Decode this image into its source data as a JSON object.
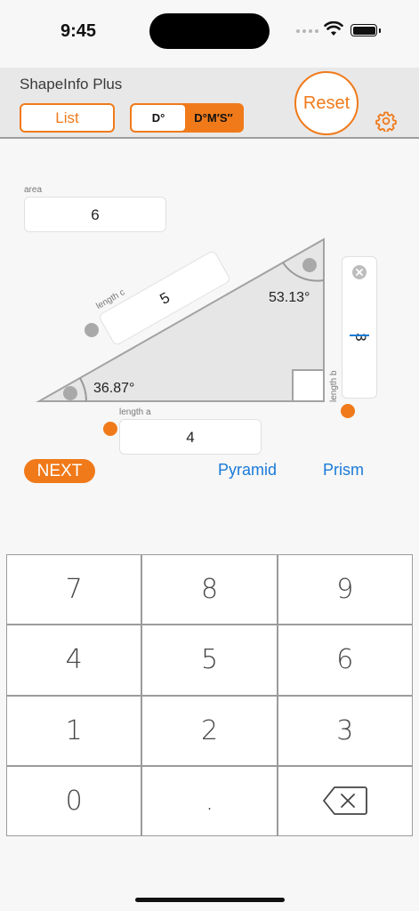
{
  "status": {
    "time": "9:45"
  },
  "header": {
    "title": "ShapeInfo Plus",
    "list_label": "List",
    "degrees_label": "D°",
    "dms_label": "D°M′S″",
    "reset_label": "Reset"
  },
  "fields": {
    "area": {
      "label": "area",
      "value": "6"
    },
    "length_a": {
      "label": "length a",
      "value": "4"
    },
    "length_b": {
      "label": "length b",
      "value": "3"
    },
    "length_c": {
      "label": "length c",
      "value": "5"
    }
  },
  "angles": {
    "top": "53.13°",
    "left": "36.87°"
  },
  "actions": {
    "next_label": "NEXT",
    "pyramid_label": "Pyramid",
    "prism_label": "Prism"
  },
  "keypad": {
    "keys": [
      "7",
      "8",
      "9",
      "4",
      "5",
      "6",
      "1",
      "2",
      "3",
      "0",
      "."
    ]
  },
  "colors": {
    "accent": "#f07a1a",
    "link": "#1a7ad8",
    "triangle_fill": "#e6e6e6"
  },
  "icons": [
    "wifi-icon",
    "battery-icon",
    "gear-icon",
    "clear-icon",
    "backspace-icon"
  ]
}
